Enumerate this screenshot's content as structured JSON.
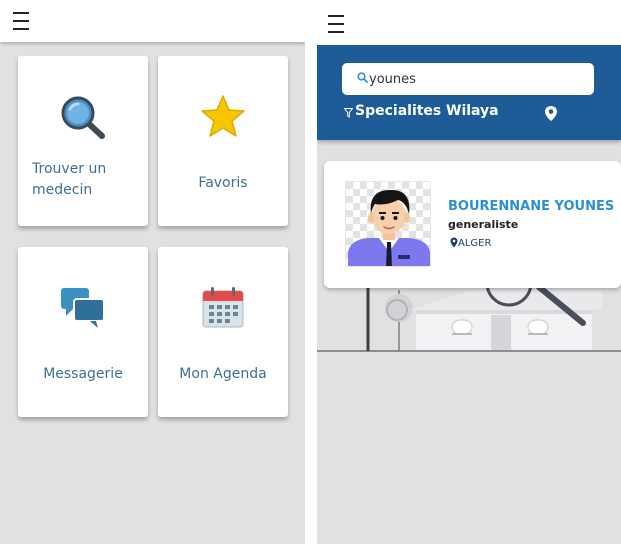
{
  "left_screen": {
    "menu_icon": "hamburger-menu-icon",
    "cards": [
      {
        "label": "Trouver un medecin",
        "icon": "magnifier-icon"
      },
      {
        "label": "Favoris",
        "icon": "star-icon"
      },
      {
        "label": "Messagerie",
        "icon": "chat-bubbles-icon"
      },
      {
        "label": "Mon Agenda",
        "icon": "calendar-icon"
      }
    ],
    "card_label_lines": {
      "find_line1": "Trouver un",
      "find_line2": "medecin"
    }
  },
  "right_screen": {
    "menu_icon": "hamburger-menu-icon",
    "search": {
      "value": "younes",
      "icon": "search-icon"
    },
    "filters": {
      "specialites": "Specialites",
      "wilaya": "Wilaya",
      "specialites_icon": "filter-icon",
      "location_icon": "map-pin-icon"
    },
    "result": {
      "name": "BOURENNANE YOUNES",
      "specialty": "generaliste",
      "city": "ALGER",
      "avatar": "doctor-avatar"
    }
  },
  "colors": {
    "header_blue": "#1d5c96",
    "label_blue": "#3e6f93",
    "name_blue": "#2c8fd6",
    "background_gray": "#e1e1e1"
  }
}
